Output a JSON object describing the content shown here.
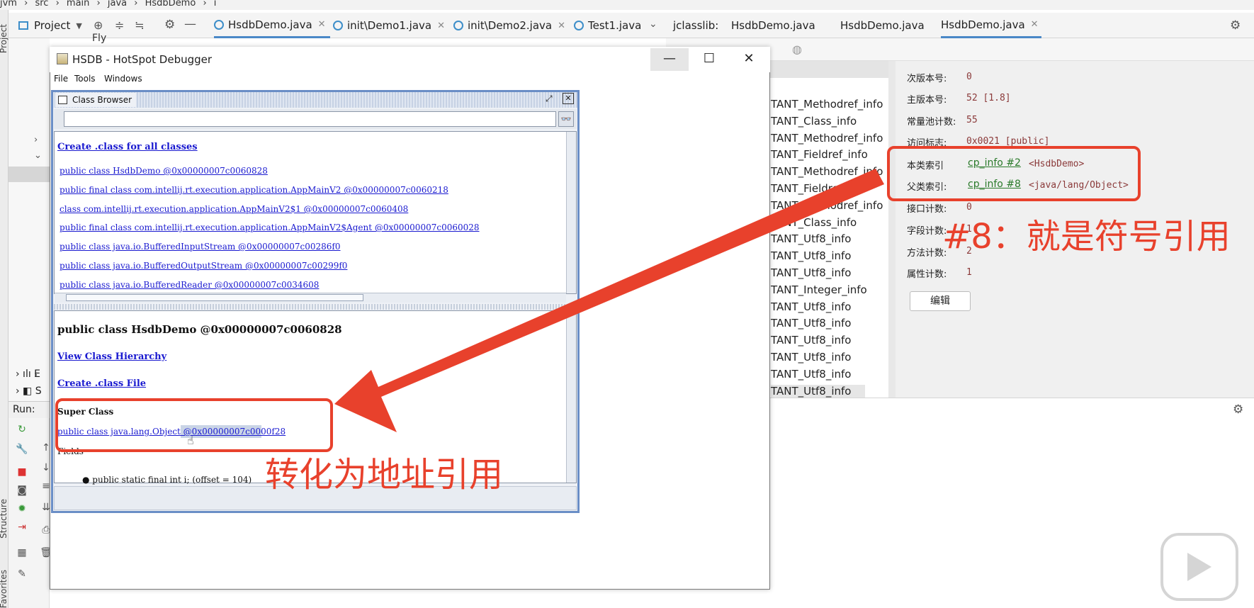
{
  "breadcrumb": [
    "jvm",
    "src",
    "main",
    "java",
    "HsdbDemo",
    "i"
  ],
  "left_strip": {
    "project_label": "Project",
    "structure_label": "Structure",
    "favorites_label": "Favorites"
  },
  "project_tabs": {
    "project_label": "Project",
    "tabs": [
      {
        "label": "HsdbDemo.java",
        "active": true
      },
      {
        "label": "init\\Demo1.java",
        "active": false
      },
      {
        "label": "init\\Demo2.java",
        "active": false
      },
      {
        "label": "Test1.java",
        "active": false
      }
    ]
  },
  "tree": {
    "fly_label": "Fly",
    "item_e": "E",
    "item_s": "S"
  },
  "run": {
    "label": "Run:"
  },
  "jclasslib": {
    "prefix": "jclasslib:",
    "tabs": [
      "HsdbDemo.java",
      "HsdbDemo.java",
      "HsdbDemo.java"
    ],
    "constant_pool": [
      "TANT_Methodref_info",
      "TANT_Class_info",
      "TANT_Methodref_info",
      "TANT_Fieldref_info",
      "TANT_Methodref_info",
      "TANT_Fieldref_info",
      "TANT_Methodref_info",
      "TANT_Class_info",
      "TANT_Utf8_info",
      "TANT_Utf8_info",
      "TANT_Utf8_info",
      "TANT_Integer_info",
      "TANT_Utf8_info",
      "TANT_Utf8_info",
      "TANT_Utf8_info",
      "TANT_Utf8_info",
      "TANT_Utf8_info",
      "TANT_Utf8_info"
    ],
    "info": {
      "minor_label": "次版本号:",
      "minor_value": "0",
      "major_label": "主版本号:",
      "major_value": "52 [1.8]",
      "cp_count_label": "常量池计数:",
      "cp_count_value": "55",
      "access_label": "访问标志:",
      "access_value": "0x0021 [public]",
      "this_label": "本类索引",
      "this_link": "cp_info #2",
      "this_value": "<HsdbDemo>",
      "super_label": "父类索引:",
      "super_link": "cp_info #8",
      "super_value": "<java/lang/Object>",
      "iface_label": "接口计数:",
      "iface_value": "0",
      "field_label": "字段计数:",
      "field_value": "1",
      "method_label": "方法计数:",
      "method_value": "2",
      "attr_label": "属性计数:",
      "attr_value": "1",
      "edit_button": "编辑"
    }
  },
  "hsdb": {
    "title": "HSDB - HotSpot Debugger",
    "menu": [
      "File",
      "Tools",
      "Windows"
    ],
    "class_browser": {
      "title": "Class Browser",
      "search_value": "",
      "create_all": "Create .class for all classes",
      "classes": [
        "public class HsdbDemo @0x00000007c0060828",
        "public final class com.intellij.rt.execution.application.AppMainV2 @0x00000007c0060218",
        "class com.intellij.rt.execution.application.AppMainV2$1 @0x00000007c0060408",
        "public final class com.intellij.rt.execution.application.AppMainV2$Agent @0x00000007c0060028",
        "public class java.io.BufferedInputStream @0x00000007c00286f0",
        "public class java.io.BufferedOutputStream @0x00000007c00299f0",
        "public class java.io.BufferedReader @0x00000007c0034608"
      ],
      "detail_title": "public class HsdbDemo @0x00000007c0060828",
      "view_hierarchy": "View Class Hierarchy",
      "create_file": "Create .class File",
      "super_class_label": "Super Class",
      "super_class_link": "public class java.lang.Object @0x00000007c0000f28",
      "fields_label": "Fields",
      "field_item": "public static final int i; (offset = 104)"
    }
  },
  "annotations": {
    "symbol_ref": "#8：就是符号引用",
    "address_ref": "转化为地址引用"
  }
}
